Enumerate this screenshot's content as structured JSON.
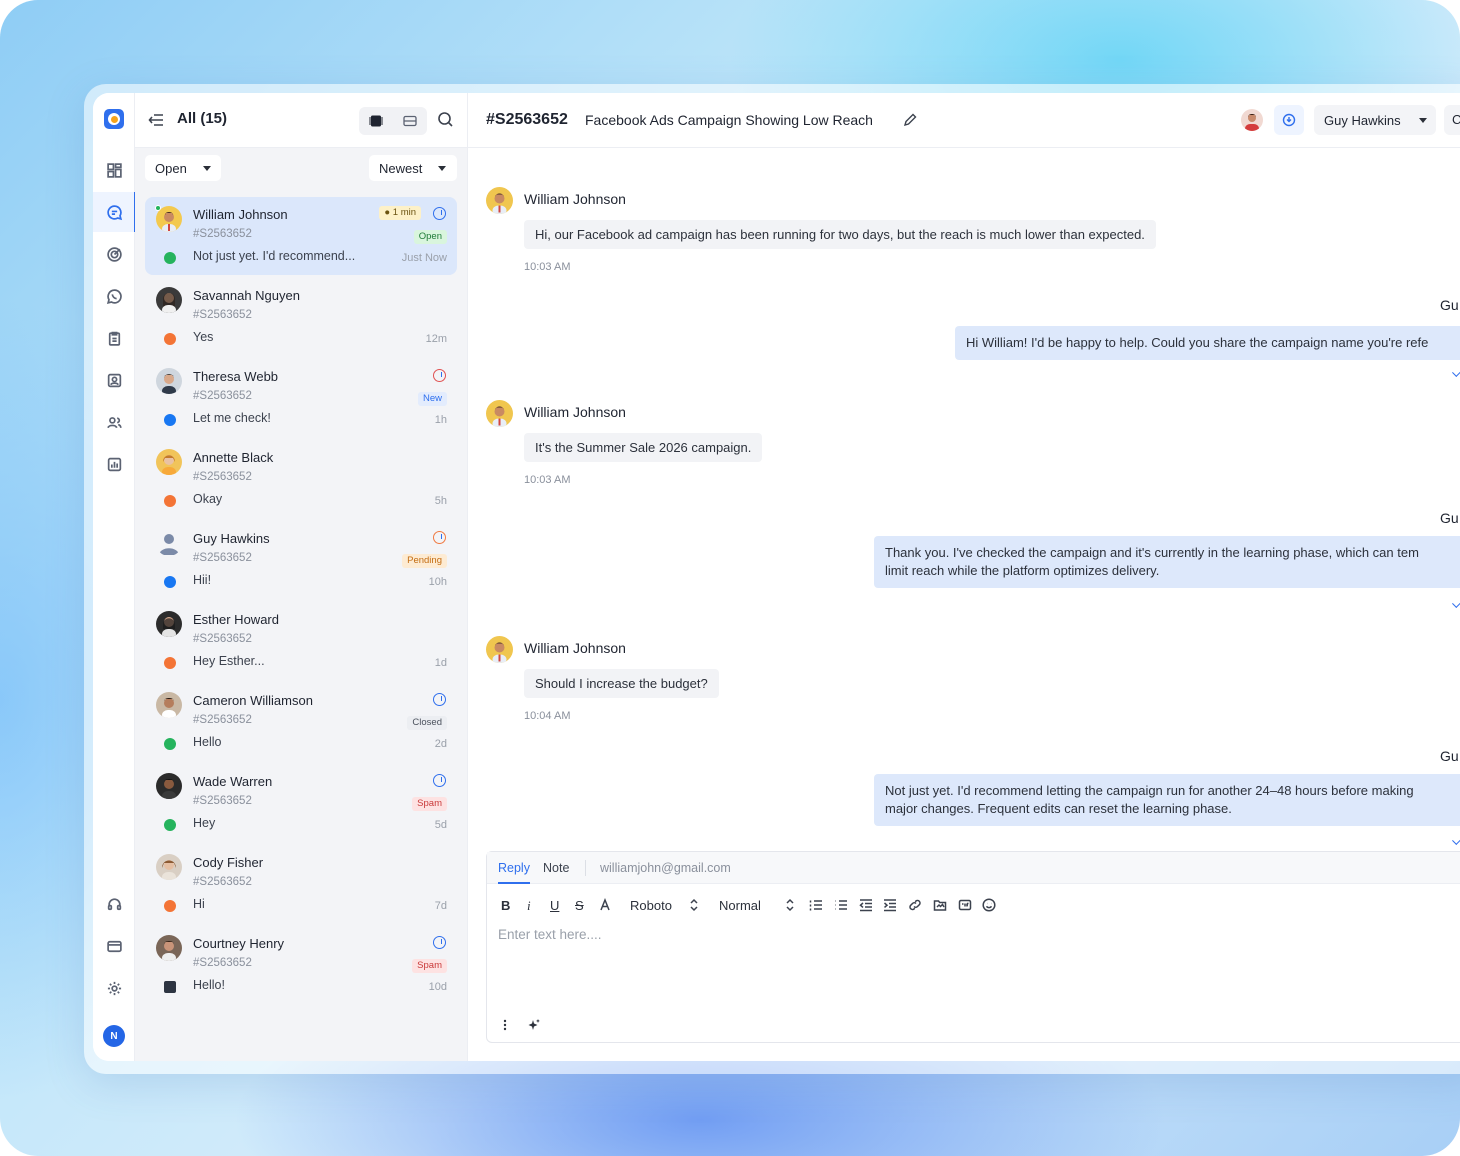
{
  "list": {
    "title": "All (15)",
    "status_filter": "Open",
    "sort": "Newest",
    "conversations": [
      {
        "name": "William Johnson",
        "id": "#S2563652",
        "message": "Not just yet. I'd recommend...",
        "time": "Just Now",
        "status": "Open",
        "timer": "1 min",
        "channel": "whatsapp"
      },
      {
        "name": "Savannah Nguyen",
        "id": "#S2563652",
        "message": "Yes",
        "time": "12m",
        "channel": "chat"
      },
      {
        "name": "Theresa Webb",
        "id": "#S2563652",
        "message": "Let me check!",
        "time": "1h",
        "status": "New",
        "channel": "facebook"
      },
      {
        "name": "Annette Black",
        "id": "#S2563652",
        "message": "Okay",
        "time": "5h",
        "channel": "chat"
      },
      {
        "name": "Guy Hawkins",
        "id": "#S2563652",
        "message": "Hii!",
        "time": "10h",
        "status": "Pending",
        "channel": "facebook"
      },
      {
        "name": "Esther Howard",
        "id": "#S2563652",
        "message": "Hey Esther...",
        "time": "1d",
        "channel": "chat"
      },
      {
        "name": "Cameron Williamson",
        "id": "#S2563652",
        "message": "Hello",
        "time": "2d",
        "status": "Closed",
        "channel": "whatsapp"
      },
      {
        "name": "Wade Warren",
        "id": "#S2563652",
        "message": "Hey",
        "time": "5d",
        "status": "Spam",
        "channel": "whatsapp"
      },
      {
        "name": "Cody Fisher",
        "id": "#S2563652",
        "message": "Hi",
        "time": "7d",
        "channel": "chat"
      },
      {
        "name": "Courtney Henry",
        "id": "#S2563652",
        "message": "Hello!",
        "time": "10d",
        "status": "Spam",
        "channel": "email"
      }
    ]
  },
  "chat": {
    "ticket_id": "#S2563652",
    "subject": "Facebook Ads Campaign Showing Low Reach",
    "assignee": "Guy Hawkins",
    "more_label": "C",
    "messages": [
      {
        "from": "William Johnson",
        "text": "Hi, our Facebook ad campaign has been running for two days, but the reach is much lower than expected.",
        "time": "10:03 AM"
      },
      {
        "from": "Gu",
        "text": "Hi William! I'd be happy to help. Could you share the campaign name you're refe"
      },
      {
        "from": "William Johnson",
        "text": "It's the Summer Sale 2026 campaign.",
        "time": "10:03 AM"
      },
      {
        "from": "Gu",
        "text_line1": "Thank you. I've checked the campaign and it's currently in the learning phase, which can tem",
        "text_line2": "limit reach while the platform optimizes delivery."
      },
      {
        "from": "William Johnson",
        "text": "Should I increase the budget?",
        "time": "10:04 AM"
      },
      {
        "from": "Gu",
        "text_line1": "Not just yet. I'd recommend letting the campaign run for another 24–48 hours before making",
        "text_line2": "major changes. Frequent edits can reset the learning phase."
      }
    ]
  },
  "composer": {
    "tab_reply": "Reply",
    "tab_note": "Note",
    "to": "williamjohn@gmail.com",
    "font": "Roboto",
    "size": "Normal",
    "placeholder": "Enter text here....",
    "bold": "B",
    "italic": "i",
    "underline": "U",
    "strike": "S"
  },
  "rail": {
    "avatar_initial": "N"
  },
  "colors": {
    "accent": "#2f6fed",
    "open": "#d9f5dd",
    "new": "#e3ecfd",
    "pending": "#fdebd3",
    "closed": "#eceef2",
    "spam": "#fde2e2"
  }
}
